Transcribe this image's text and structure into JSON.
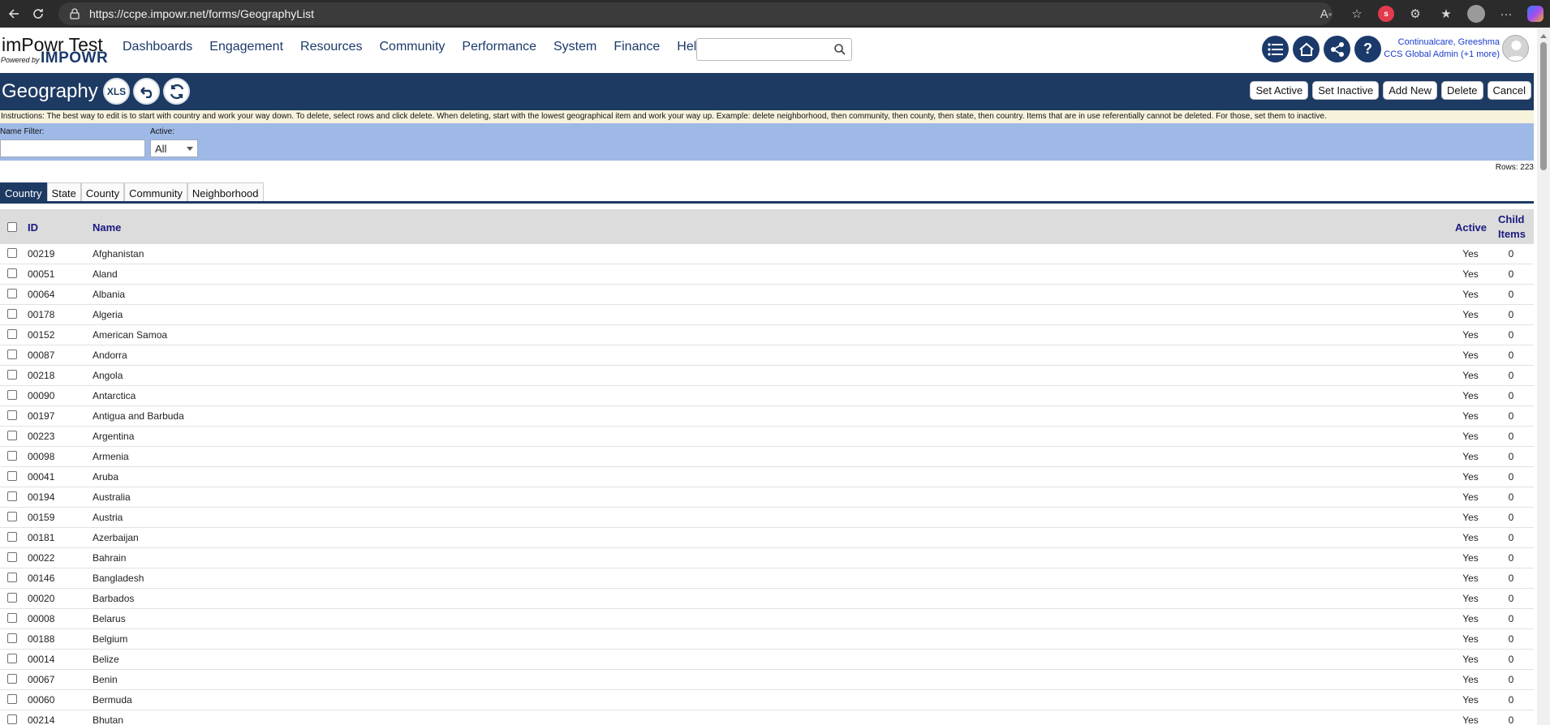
{
  "browser": {
    "url": "https://ccpe.impowr.net/forms/GeographyList"
  },
  "header": {
    "app_title": "imPowr Test",
    "powered_by": "Powered by",
    "brand": "IMPOWR",
    "nav": [
      "Dashboards",
      "Engagement",
      "Resources",
      "Community",
      "Performance",
      "System",
      "Finance",
      "Help"
    ],
    "user_name": "Continualcare, Greeshma",
    "user_role": "CCS Global Admin (+1 more)"
  },
  "title_band": {
    "title": "Geography",
    "xls_label": "XLS",
    "buttons": [
      "Set Active",
      "Set Inactive",
      "Add New",
      "Delete",
      "Cancel"
    ]
  },
  "instructions": "Instructions: The best way to edit is to start with country and work your way down. To delete, select rows and click delete. When deleting, start with the lowest geographical item and work your way up. Example: delete neighborhood, then community, then county, then state, then country. Items that are in use referentially cannot be deleted. For those, set them to inactive.",
  "filters": {
    "name_label": "Name Filter:",
    "name_value": "",
    "active_label": "Active:",
    "active_value": "All"
  },
  "rows_count": "Rows: 223",
  "tabs": [
    "Country",
    "State",
    "County",
    "Community",
    "Neighborhood"
  ],
  "table": {
    "columns": {
      "id": "ID",
      "name": "Name",
      "active": "Active",
      "child1": "Child",
      "child2": "Items"
    },
    "rows": [
      {
        "id": "00219",
        "name": "Afghanistan",
        "active": "Yes",
        "child": "0"
      },
      {
        "id": "00051",
        "name": "Aland",
        "active": "Yes",
        "child": "0"
      },
      {
        "id": "00064",
        "name": "Albania",
        "active": "Yes",
        "child": "0"
      },
      {
        "id": "00178",
        "name": "Algeria",
        "active": "Yes",
        "child": "0"
      },
      {
        "id": "00152",
        "name": "American Samoa",
        "active": "Yes",
        "child": "0"
      },
      {
        "id": "00087",
        "name": "Andorra",
        "active": "Yes",
        "child": "0"
      },
      {
        "id": "00218",
        "name": "Angola",
        "active": "Yes",
        "child": "0"
      },
      {
        "id": "00090",
        "name": "Antarctica",
        "active": "Yes",
        "child": "0"
      },
      {
        "id": "00197",
        "name": "Antigua and Barbuda",
        "active": "Yes",
        "child": "0"
      },
      {
        "id": "00223",
        "name": "Argentina",
        "active": "Yes",
        "child": "0"
      },
      {
        "id": "00098",
        "name": "Armenia",
        "active": "Yes",
        "child": "0"
      },
      {
        "id": "00041",
        "name": "Aruba",
        "active": "Yes",
        "child": "0"
      },
      {
        "id": "00194",
        "name": "Australia",
        "active": "Yes",
        "child": "0"
      },
      {
        "id": "00159",
        "name": "Austria",
        "active": "Yes",
        "child": "0"
      },
      {
        "id": "00181",
        "name": "Azerbaijan",
        "active": "Yes",
        "child": "0"
      },
      {
        "id": "00022",
        "name": "Bahrain",
        "active": "Yes",
        "child": "0"
      },
      {
        "id": "00146",
        "name": "Bangladesh",
        "active": "Yes",
        "child": "0"
      },
      {
        "id": "00020",
        "name": "Barbados",
        "active": "Yes",
        "child": "0"
      },
      {
        "id": "00008",
        "name": "Belarus",
        "active": "Yes",
        "child": "0"
      },
      {
        "id": "00188",
        "name": "Belgium",
        "active": "Yes",
        "child": "0"
      },
      {
        "id": "00014",
        "name": "Belize",
        "active": "Yes",
        "child": "0"
      },
      {
        "id": "00067",
        "name": "Benin",
        "active": "Yes",
        "child": "0"
      },
      {
        "id": "00060",
        "name": "Bermuda",
        "active": "Yes",
        "child": "0"
      },
      {
        "id": "00214",
        "name": "Bhutan",
        "active": "Yes",
        "child": "0"
      }
    ]
  }
}
